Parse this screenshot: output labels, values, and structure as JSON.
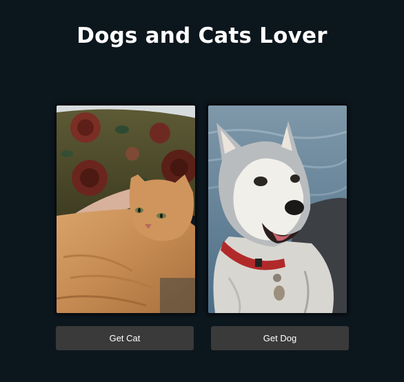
{
  "page": {
    "title": "Dogs and Cats Lover",
    "background": "#0c161d"
  },
  "cards": {
    "cat": {
      "image_subject": "orange tabby cat lying on floral couch"
    },
    "dog": {
      "image_subject": "siberian husky with red collar"
    }
  },
  "buttons": {
    "get_cat": "Get Cat",
    "get_dog": "Get Dog",
    "color": "#3a3a3a"
  }
}
